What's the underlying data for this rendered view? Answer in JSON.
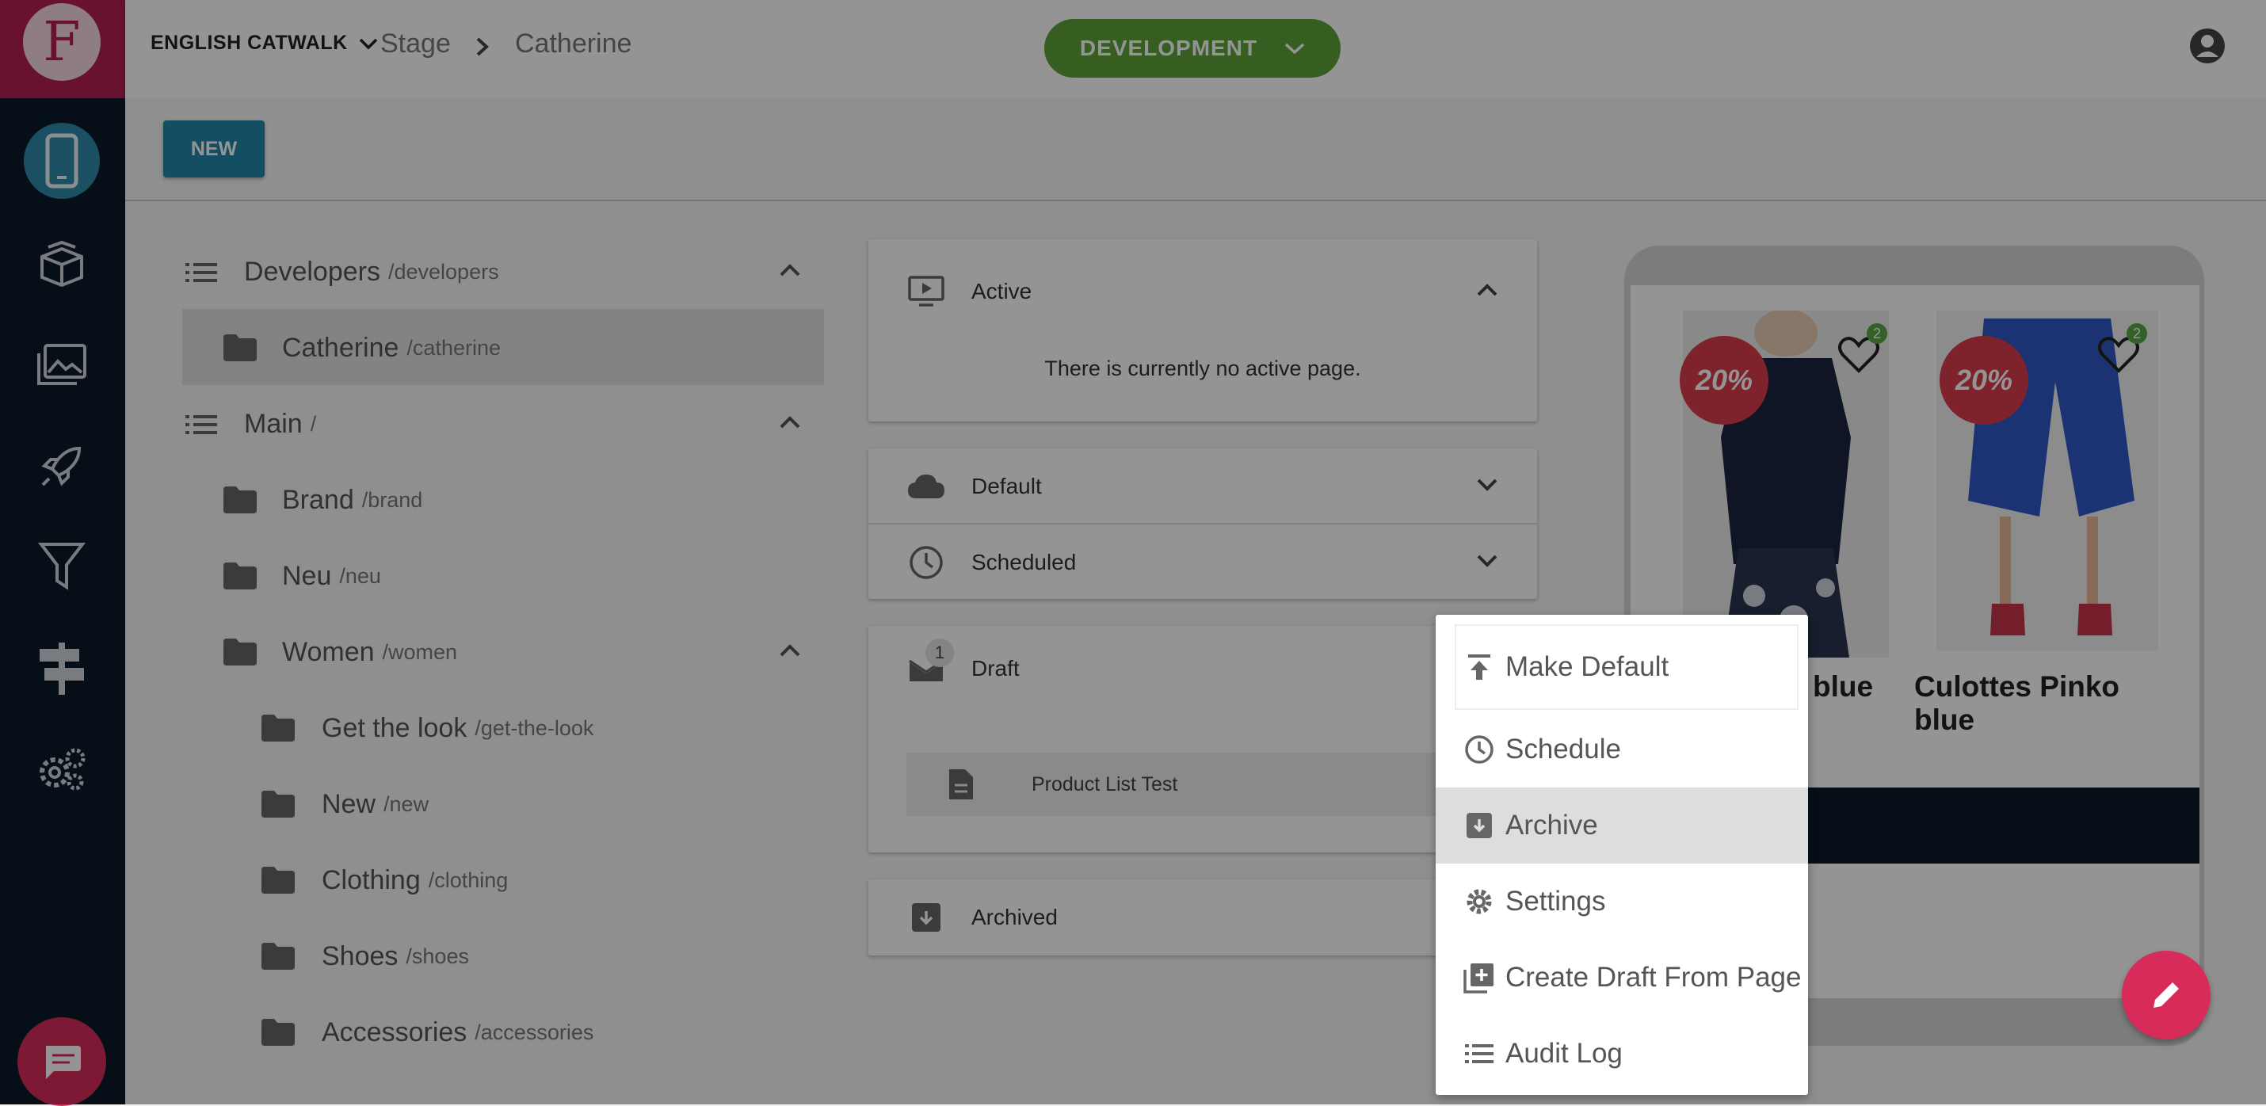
{
  "app": {
    "logo_letter": "F",
    "nav_items": [
      "mobile-icon",
      "box-icon",
      "images-icon",
      "rocket-icon",
      "filter-icon",
      "signpost-icon",
      "settings-icon"
    ]
  },
  "header": {
    "catalog_label": "ENGLISH CATWALK",
    "breadcrumb": [
      "Stage",
      "Catherine"
    ],
    "environment_label": "DEVELOPMENT"
  },
  "toolbar": {
    "new_label": "NEW"
  },
  "tree": [
    {
      "name": "Developers",
      "path": "/developers"
    },
    {
      "name": "Catherine",
      "path": "/catherine"
    },
    {
      "name": "Main",
      "path": "/"
    },
    {
      "name": "Brand",
      "path": "/brand"
    },
    {
      "name": "Neu",
      "path": "/neu"
    },
    {
      "name": "Women",
      "path": "/women"
    },
    {
      "name": "Get the look",
      "path": "/get-the-look"
    },
    {
      "name": "New",
      "path": "/new"
    },
    {
      "name": "Clothing",
      "path": "/clothing"
    },
    {
      "name": "Shoes",
      "path": "/shoes"
    },
    {
      "name": "Accessories",
      "path": "/accessories"
    }
  ],
  "panels": {
    "active": {
      "title": "Active",
      "empty_text": "There is currently no active page."
    },
    "default": {
      "title": "Default"
    },
    "scheduled": {
      "title": "Scheduled"
    },
    "draft": {
      "title": "Draft",
      "count": "1",
      "item": "Product List Test"
    },
    "archived": {
      "title": "Archived"
    }
  },
  "preview": {
    "products": [
      {
        "discount": "20%",
        "likes": "2",
        "name": "blue"
      },
      {
        "discount": "20%",
        "likes": "2",
        "name": "Culottes Pinko blue"
      }
    ]
  },
  "context_menu": {
    "items": [
      {
        "label": "Make Default",
        "icon": "upload-icon"
      },
      {
        "label": "Schedule",
        "icon": "clock-icon"
      },
      {
        "label": "Archive",
        "icon": "archive-icon"
      },
      {
        "label": "Settings",
        "icon": "gear-icon"
      },
      {
        "label": "Create Draft From Page",
        "icon": "copy-plus-icon"
      },
      {
        "label": "Audit Log",
        "icon": "list-icon"
      }
    ]
  },
  "colors": {
    "brand": "#b51f52",
    "nav_bg": "#0c1b2a",
    "accent": "#2487ab",
    "environment": "#5ea23a"
  }
}
